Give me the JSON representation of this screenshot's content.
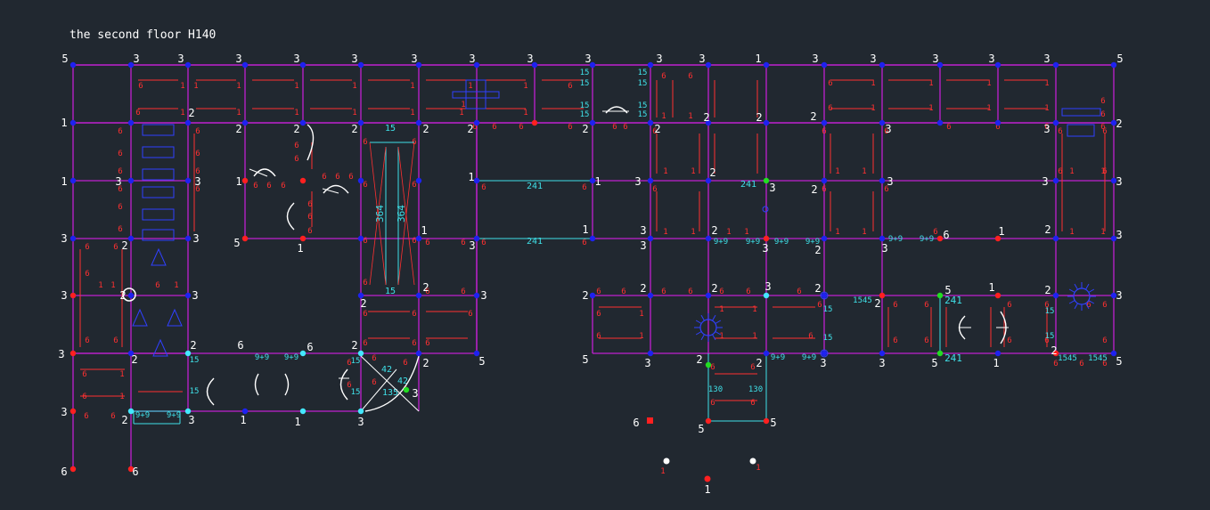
{
  "title": "the second floor H140",
  "colors": {
    "background": "#212830",
    "wall": "#c020d0",
    "beam": "#ff3030",
    "dim": "#3fe0e8",
    "node_blue": "#1e22f0",
    "node_red": "#ff2020",
    "node_green": "#22dd22",
    "node_cyan": "#44e8ff",
    "label": "#ffffff",
    "door": "#ffffff",
    "stair": "#3040ff"
  },
  "top_row_labels": [
    "5",
    "3",
    "3",
    "3",
    "3",
    "3",
    "3",
    "3",
    "3",
    "3",
    "3",
    "3",
    "1",
    "3",
    "3",
    "3",
    "3",
    "3",
    "5"
  ],
  "second_row_labels": [
    "2",
    "2",
    "2",
    "2",
    "2",
    "2",
    "2",
    "2",
    "2",
    "3",
    "3",
    "2",
    "2",
    "2"
  ],
  "mid_labels": [
    "3",
    "3",
    "1",
    "2",
    "1",
    "3",
    "3",
    "2",
    "3",
    "3",
    "3",
    "3"
  ],
  "row4_labels": [
    "3",
    "2",
    "5",
    "1",
    "1",
    "1",
    "3",
    "2",
    "3",
    "3",
    "2",
    "6",
    "1",
    "2",
    "3"
  ],
  "row5_labels": [
    "3",
    "2",
    "3",
    "2",
    "2",
    "3",
    "2",
    "2",
    "2",
    "3",
    "2",
    "2",
    "5",
    "1",
    "2",
    "3"
  ],
  "row6_labels": [
    "3",
    "2",
    "2",
    "6",
    "6",
    "2",
    "2",
    "5",
    "5",
    "3",
    "2",
    "2",
    "3",
    "3",
    "5",
    "1",
    "2",
    "5"
  ],
  "row7_labels": [
    "3",
    "2",
    "3",
    "1",
    "1",
    "3",
    "3"
  ],
  "dim_labels": [
    "15",
    "364",
    "364",
    "15",
    "241",
    "241",
    "241",
    "9+9",
    "9+9",
    "9+9",
    "9+9",
    "1545",
    "241",
    "241",
    "1545",
    "1545",
    "130",
    "130",
    "42",
    "42",
    "135",
    "9+9",
    "9+9",
    "9+9"
  ],
  "beam_labels": [
    "6",
    "1",
    "6",
    "6",
    "1",
    "1",
    "1",
    "6",
    "9"
  ],
  "bottom_labels": [
    "6",
    "6",
    "6",
    "5",
    "5",
    "1",
    "1",
    "1"
  ]
}
